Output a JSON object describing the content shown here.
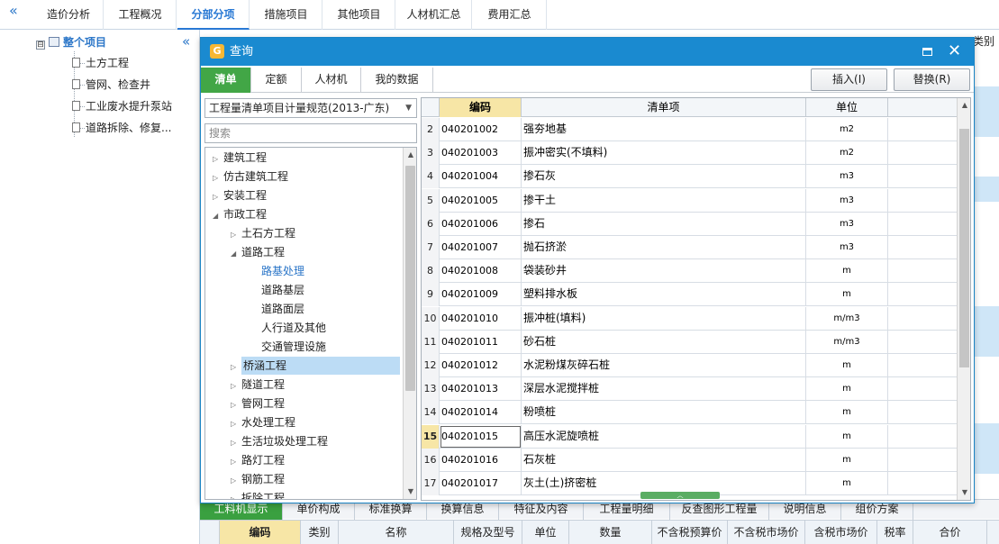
{
  "topbar": {
    "collapse_icon": "«",
    "tabs": [
      "造价分析",
      "工程概况",
      "分部分项",
      "措施项目",
      "其他项目",
      "人材机汇总",
      "费用汇总"
    ]
  },
  "left_panel": {
    "collapse_icon": "«",
    "root_toggle": "⊟",
    "root": "整个项目",
    "items": [
      "土方工程",
      "管网、检查井",
      "工业废水提升泵站",
      "道路拆除、修复..."
    ]
  },
  "bg": {
    "col_header": "类别"
  },
  "dialog": {
    "title": "查询",
    "tabs": [
      "清单",
      "定额",
      "人材机",
      "我的数据"
    ],
    "buttons": {
      "insert": "插入(I)",
      "replace": "替换(R)"
    },
    "library_select": "工程量清单项目计量规范(2013-广东)",
    "search_placeholder": "搜索",
    "tree": [
      {
        "label": "建筑工程",
        "arrow": "▷"
      },
      {
        "label": "仿古建筑工程",
        "arrow": "▷"
      },
      {
        "label": "安装工程",
        "arrow": "▷"
      },
      {
        "label": "市政工程",
        "arrow": "◢"
      },
      {
        "label": "土石方工程",
        "arrow": "▷"
      },
      {
        "label": "道路工程",
        "arrow": "◢"
      },
      {
        "label": "路基处理",
        "arrow": ""
      },
      {
        "label": "道路基层",
        "arrow": ""
      },
      {
        "label": "道路面层",
        "arrow": ""
      },
      {
        "label": "人行道及其他",
        "arrow": ""
      },
      {
        "label": "交通管理设施",
        "arrow": ""
      },
      {
        "label": "桥涵工程",
        "arrow": "▷"
      },
      {
        "label": "隧道工程",
        "arrow": "▷"
      },
      {
        "label": "管网工程",
        "arrow": "▷"
      },
      {
        "label": "水处理工程",
        "arrow": "▷"
      },
      {
        "label": "生活垃圾处理工程",
        "arrow": "▷"
      },
      {
        "label": "路灯工程",
        "arrow": "▷"
      },
      {
        "label": "钢筋工程",
        "arrow": "▷"
      },
      {
        "label": "拆除工程",
        "arrow": "▷"
      }
    ],
    "grid": {
      "headers": [
        "编码",
        "清单项",
        "单位"
      ],
      "rows": [
        [
          "2",
          "040201002",
          "强夯地基",
          "m2"
        ],
        [
          "3",
          "040201003",
          "振冲密实(不填料)",
          "m2"
        ],
        [
          "4",
          "040201004",
          "掺石灰",
          "m3"
        ],
        [
          "5",
          "040201005",
          "掺干土",
          "m3"
        ],
        [
          "6",
          "040201006",
          "掺石",
          "m3"
        ],
        [
          "7",
          "040201007",
          "抛石挤淤",
          "m3"
        ],
        [
          "8",
          "040201008",
          "袋装砂井",
          "m"
        ],
        [
          "9",
          "040201009",
          "塑料排水板",
          "m"
        ],
        [
          "10",
          "040201010",
          "振冲桩(填料)",
          "m/m3"
        ],
        [
          "11",
          "040201011",
          "砂石桩",
          "m/m3"
        ],
        [
          "12",
          "040201012",
          "水泥粉煤灰碎石桩",
          "m"
        ],
        [
          "13",
          "040201013",
          "深层水泥搅拌桩",
          "m"
        ],
        [
          "14",
          "040201014",
          "粉喷桩",
          "m"
        ],
        [
          "15",
          "040201015",
          "高压水泥旋喷桩",
          "m"
        ],
        [
          "16",
          "040201016",
          "石灰桩",
          "m"
        ],
        [
          "17",
          "040201017",
          "灰土(土)挤密桩",
          "m"
        ]
      ]
    }
  },
  "bottom_tabs": [
    "工料机显示",
    "单价构成",
    "标准换算",
    "换算信息",
    "特征及内容",
    "工程量明细",
    "反查图形工程量",
    "说明信息",
    "组价方案"
  ],
  "bottom_headers": [
    "编码",
    "类别",
    "名称",
    "规格及型号",
    "单位",
    "数量",
    "不含税预算价",
    "不含税市场价",
    "含税市场价",
    "税率",
    "合价"
  ]
}
